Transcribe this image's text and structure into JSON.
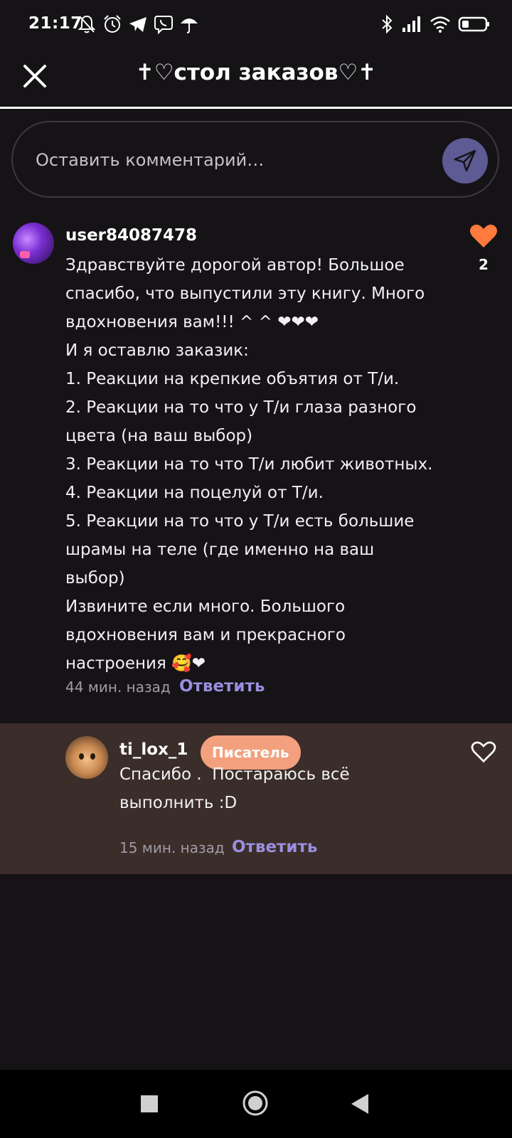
{
  "status_bar": {
    "time": "21:17",
    "left_icons": [
      "bell-off-icon",
      "alarm-icon",
      "telegram-icon",
      "viber-icon",
      "umbrella-icon"
    ],
    "right_icons": [
      "bluetooth-icon",
      "signal-icon",
      "wifi-icon",
      "battery-icon"
    ]
  },
  "header": {
    "title": "✝♡стол заказов♡✝",
    "close_icon": "close-icon"
  },
  "comment_input": {
    "placeholder": "Оставить комментарий…",
    "send_icon": "send-icon"
  },
  "comments": [
    {
      "username": "user84087478",
      "text": "Здравствуйте дорогой автор! Большое\nспасибо, что выпустили эту книгу. Много\nвдохновения вам!!! ^ ^ ❤❤❤\nИ я оставлю заказик:\n1. Реакции на крепкие объятия от Т/и.\n2. Реакции на то что у Т/и глаза разного\nцвета (на ваш выбор)\n3. Реакции на то что Т/и любит животных.\n4. Реакции на поцелуй от Т/и.\n5. Реакции на то что у Т/и есть большие\nшрамы на теле (где именно на ваш\nвыбор)\nИзвините если много. Большого\nвдохновения вам и прекрасного\nнастроения 🥰❤",
      "time": "44 мин. назад",
      "reply_label": "Ответить",
      "likes": "2",
      "liked": true
    }
  ],
  "reply": {
    "username": "ti_lox_1",
    "badge": "Писатель",
    "text": "Спасибо .  Постараюсь всё\nвыполнить :D",
    "time": "15 мин. назад",
    "reply_label": "Ответить",
    "liked": false
  },
  "colors": {
    "background": "#151316",
    "reply_background": "#3b2d29",
    "accent": "#9a8fe0",
    "like": "#ff7a3d",
    "badge": "#f2a07d",
    "send_button": "#5d5a94"
  },
  "nav_bar": {
    "buttons": [
      "recent-apps-icon",
      "home-icon",
      "back-icon"
    ]
  }
}
